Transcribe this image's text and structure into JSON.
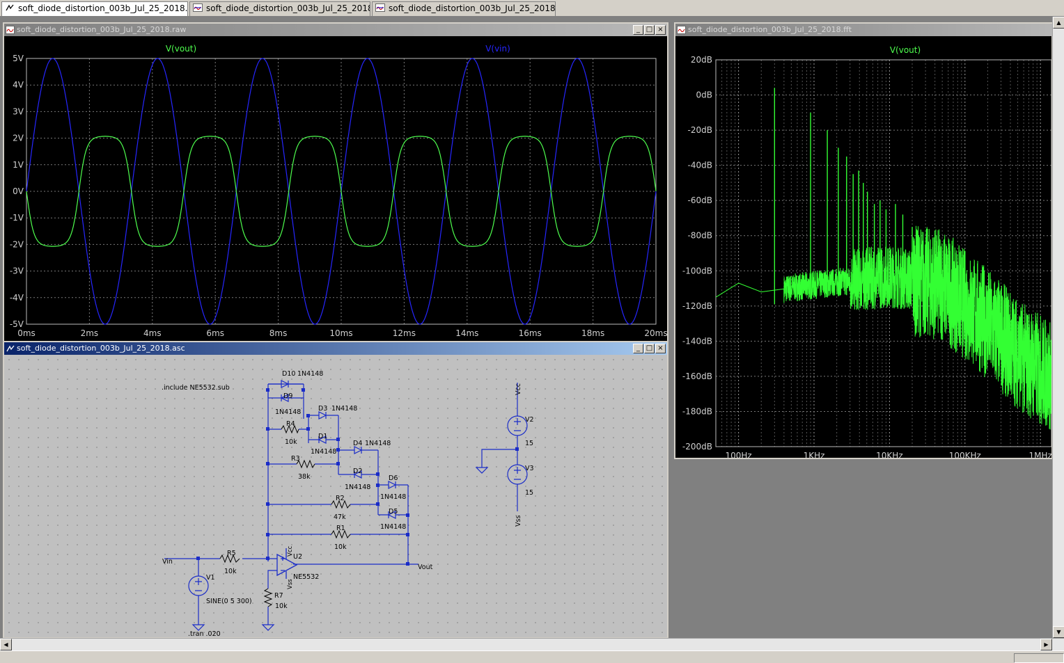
{
  "tabs": [
    {
      "label": "soft_diode_distortion_003b_Jul_25_2018.asc",
      "icon": "schematic-icon",
      "active": true
    },
    {
      "label": "soft_diode_distortion_003b_Jul_25_2018.fft",
      "icon": "waveform-icon",
      "active": false
    },
    {
      "label": "soft_diode_distortion_003b_Jul_25_2018.raw",
      "icon": "waveform-icon",
      "active": false
    }
  ],
  "windows": {
    "raw": {
      "title": "soft_diode_distortion_003b_Jul_25_2018.raw",
      "active": false
    },
    "asc": {
      "title": "soft_diode_distortion_003b_Jul_25_2018.asc",
      "active": true
    },
    "fft": {
      "title": "soft_diode_distortion_003b_Jul_25_2018.fft",
      "active": false
    }
  },
  "window_buttons": {
    "minimize": "_",
    "maximize": "□",
    "close": "×"
  },
  "scroll_arrows": {
    "up": "▲",
    "down": "▼",
    "left": "◀",
    "right": "▶"
  },
  "colors": {
    "vout": "#4eff4e",
    "vin": "#2626ff",
    "fft_trace": "#33ff33",
    "plot_bg": "#000000",
    "grid": "#7a7a7a",
    "tick_label": "#d0d0d0",
    "wire": "#1a2cc8",
    "component": "#1a2cc8",
    "schematic_text": "#000000"
  },
  "chart_data": [
    {
      "type": "line",
      "title": "",
      "xlabel": "",
      "ylabel": "",
      "x_ticks": [
        "0ms",
        "2ms",
        "4ms",
        "6ms",
        "8ms",
        "10ms",
        "12ms",
        "14ms",
        "16ms",
        "18ms",
        "20ms"
      ],
      "y_ticks": [
        "5V",
        "4V",
        "3V",
        "2V",
        "1V",
        "0V",
        "-1V",
        "-2V",
        "-3V",
        "-4V",
        "-5V"
      ],
      "xlim": [
        0,
        20
      ],
      "ylim": [
        -5,
        5
      ],
      "grid": true,
      "legend": "top",
      "series": [
        {
          "name": "V(vout)",
          "freq_hz": 300,
          "amplitude_v": 2.07,
          "phase": "inverted",
          "shape": "soft-clipped sine"
        },
        {
          "name": "V(vin)",
          "freq_hz": 300,
          "amplitude_v": 5.0,
          "phase": "normal",
          "shape": "sine"
        }
      ]
    },
    {
      "type": "line",
      "title": "",
      "xlabel": "",
      "ylabel": "",
      "x_scale": "log",
      "x_ticks": [
        "100Hz",
        "1KHz",
        "10KHz",
        "100KHz",
        "1MHz"
      ],
      "y_ticks": [
        "20dB",
        "0dB",
        "-20dB",
        "-40dB",
        "-60dB",
        "-80dB",
        "-100dB",
        "-120dB",
        "-140dB",
        "-160dB",
        "-180dB",
        "-200dB"
      ],
      "xlim_hz": [
        50,
        1400000
      ],
      "ylim": [
        -200,
        20
      ],
      "grid": true,
      "legend": "top",
      "series": [
        {
          "name": "V(vout)",
          "harmonics": [
            {
              "freq_hz": 300,
              "db": 4
            },
            {
              "freq_hz": 900,
              "db": -10
            },
            {
              "freq_hz": 1500,
              "db": -20
            },
            {
              "freq_hz": 2100,
              "db": -30
            },
            {
              "freq_hz": 2700,
              "db": -35
            },
            {
              "freq_hz": 3300,
              "db": -45
            },
            {
              "freq_hz": 3900,
              "db": -43
            },
            {
              "freq_hz": 4500,
              "db": -50
            },
            {
              "freq_hz": 5100,
              "db": -55
            },
            {
              "freq_hz": 6300,
              "db": -62
            },
            {
              "freq_hz": 7500,
              "db": -60
            },
            {
              "freq_hz": 9000,
              "db": -65
            },
            {
              "freq_hz": 12000,
              "db": -62
            },
            {
              "freq_hz": 15000,
              "db": -68
            },
            {
              "freq_hz": 20000,
              "db": -75
            }
          ],
          "noise_floor": [
            {
              "freq_hz": 50,
              "db": -115
            },
            {
              "freq_hz": 100,
              "db": -107
            },
            {
              "freq_hz": 200,
              "db": -112
            },
            {
              "freq_hz": 1000,
              "db": -108
            },
            {
              "freq_hz": 10000,
              "db": -103
            },
            {
              "freq_hz": 50000,
              "db": -108
            },
            {
              "freq_hz": 200000,
              "db": -130
            },
            {
              "freq_hz": 600000,
              "db": -150
            },
            {
              "freq_hz": 1400000,
              "db": -160
            }
          ]
        }
      ]
    }
  ],
  "schematic": {
    "directive_include": ".include NE5532.sub",
    "directive_tran": ".tran .020",
    "labels": {
      "d10": "D10",
      "d10_model": "1N4148",
      "d9": "D9",
      "d9_model": "1N4148",
      "d3": "D3",
      "d3_model": "1N4148",
      "d1": "D1",
      "d1_model": "1N4148",
      "d4": "D4",
      "d4_model": "1N4148",
      "d2": "D2",
      "d2_model": "1N4148",
      "d6": "D6",
      "d6_model": "1N4148",
      "d5": "D5",
      "d5_model": "1N4148",
      "r4": "R4",
      "r4_val": "10k",
      "r3": "R3",
      "r3_val": "38k",
      "r2": "R2",
      "r2_val": "47k",
      "r1": "R1",
      "r1_val": "10k",
      "r5": "R5",
      "r5_val": "10k",
      "r7": "R7",
      "r7_val": "10k",
      "u2": "U2",
      "u2_model": "NE5532",
      "v1": "V1",
      "v1_val": "SINE(0 5 300)",
      "v2": "V2",
      "v2_val": "15",
      "v3": "V3",
      "v3_val": "15",
      "vin": "Vin",
      "vout": "Vout",
      "vcc": "Vcc",
      "vss": "Vss",
      "u2_vcc": "Vcc",
      "u2_vss": "Vss"
    }
  }
}
